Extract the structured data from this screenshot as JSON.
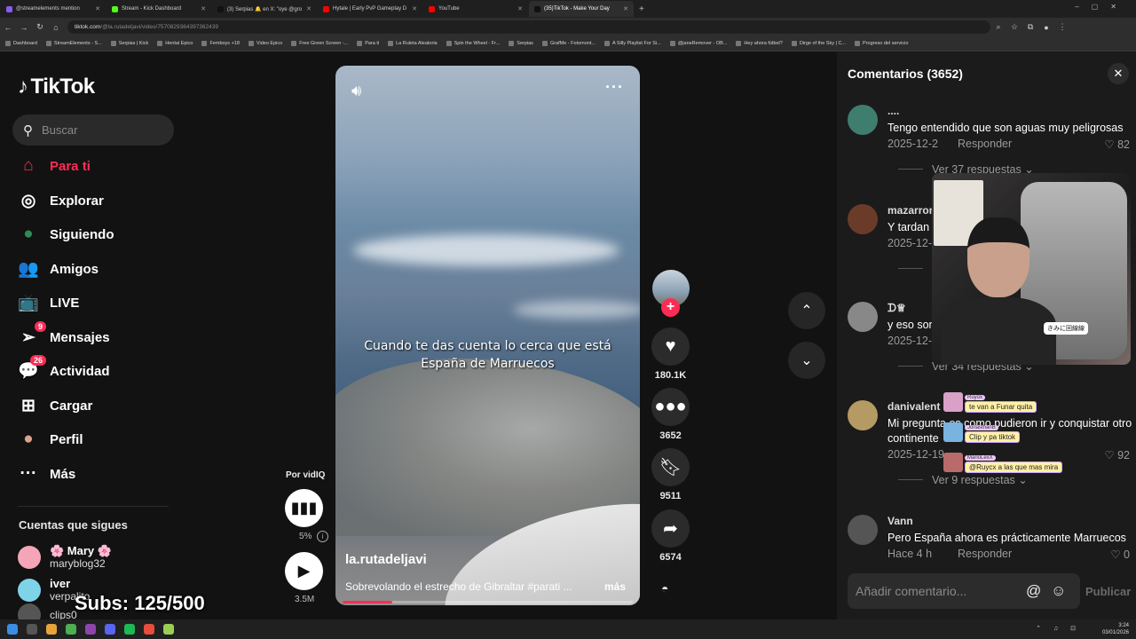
{
  "browser": {
    "tabs": [
      {
        "label": "@streamelements mention",
        "color": "#8a5cf6"
      },
      {
        "label": "Stream - Kick Dashboard",
        "color": "#53fc18"
      },
      {
        "label": "(3) Serpias 🔔 en X: \"oye @gro",
        "color": "#111111"
      },
      {
        "label": "Hytale | Early PvP Gameplay D",
        "color": "#ff0000"
      },
      {
        "label": "YouTube",
        "color": "#ff0000"
      },
      {
        "label": "(35)TikTok - Make Your Day",
        "color": "#111111",
        "active": true
      }
    ],
    "new_tab": "+",
    "url_host": "tiktok.com",
    "url_path": "/@la.rutadeljavi/video/7570829364397362439",
    "bookmarks": [
      "Dashboard",
      "StreamElements - S...",
      "Serpias | Kick",
      "Hentai Epico",
      "Femboys +18",
      "Video Epico",
      "Free Green Screen -...",
      "Para ti",
      "La Ruleta Aleatoria",
      "Spin the Wheel - Fr...",
      "Serpias",
      "GrafMe - Fotomont...",
      "A Silly Playlist For Si...",
      "@janeRemover - OB...",
      "Hey ahora fútbol?",
      "Dirge of the Sky | C...",
      "Progreso del servicio"
    ]
  },
  "sidebar": {
    "logo": "TikTok",
    "search_placeholder": "Buscar",
    "nav": [
      {
        "label": "Para ti",
        "icon": "home-icon",
        "glyph": "⌂",
        "active": true
      },
      {
        "label": "Explorar",
        "icon": "compass-icon",
        "glyph": "◎"
      },
      {
        "label": "Siguiendo",
        "icon": "following-avatar-icon",
        "glyph": "●"
      },
      {
        "label": "Amigos",
        "icon": "friends-icon",
        "glyph": "👥"
      },
      {
        "label": "LIVE",
        "icon": "live-icon",
        "glyph": "📺"
      },
      {
        "label": "Mensajes",
        "icon": "messages-icon",
        "glyph": "➢",
        "badge": "9"
      },
      {
        "label": "Actividad",
        "icon": "activity-icon",
        "glyph": "💬",
        "badge": "26"
      },
      {
        "label": "Cargar",
        "icon": "upload-icon",
        "glyph": "⊞"
      },
      {
        "label": "Perfil",
        "icon": "profile-avatar-icon",
        "glyph": "●"
      },
      {
        "label": "Más",
        "icon": "more-icon",
        "glyph": "···"
      }
    ],
    "following_title": "Cuentas que sigues",
    "following": [
      {
        "name": "🌸 Mary 🌸",
        "user": "maryblog32"
      },
      {
        "name": "iver",
        "user": "verpalito"
      },
      {
        "name": "",
        "user": "clips0"
      }
    ]
  },
  "subs_overlay": "Subs: 125/500",
  "video": {
    "caption": "Cuando te das cuenta lo cerca que está España de Marruecos",
    "author": "la.rutadeljavi",
    "description": "Sobrevolando el estrecho de Gibraltar #parati ...",
    "more": "más",
    "progress": 0.17
  },
  "actions": {
    "likes": "180.1K",
    "comments": "3652",
    "saves": "9511",
    "shares": "6574"
  },
  "vidiq": {
    "label": "Por vidIQ",
    "percent": "5%",
    "views": "3.5M"
  },
  "comments": {
    "title": "Comentarios (3652)",
    "items": [
      {
        "name": "....",
        "text": "Tengo entendido que son aguas muy peligrosas",
        "date": "2025-12-2",
        "reply": "Responder",
        "likes": "82",
        "replies": "Ver 37 respuestas",
        "avatar": "#3f7d6e"
      },
      {
        "name": "mazarron",
        "text": "Y tardan",
        "date": "2025-12-",
        "reply": "",
        "likes": "",
        "replies": "Ve",
        "avatar": "#6b3b2a"
      },
      {
        "name": "ᗪ♕",
        "text": "y eso son",
        "date": "2025-12-",
        "reply": "",
        "likes": "",
        "replies": "Ver 34 respuestas",
        "avatar": "#888888"
      },
      {
        "name": "danivalent",
        "text": "Mi pregunta es como pudieron ir y conquistar otro continente",
        "date": "2025-12-19",
        "reply": "",
        "likes": "92",
        "replies": "Ver 9 respuestas",
        "avatar": "#b59a63"
      },
      {
        "name": "Vann",
        "text": "Pero España ahora es prácticamente Marruecos",
        "date": "Hace 4 h",
        "reply": "Responder",
        "likes": "0",
        "replies": "",
        "avatar": "#555555"
      }
    ],
    "input_placeholder": "Añadir comentario...",
    "publish": "Publicar"
  },
  "chat_overlay": [
    {
      "user": "Ruyox",
      "msg": "te van a Funar quita"
    },
    {
      "user": "JonasthanB",
      "msg": "Clip y pa tiktok"
    },
    {
      "user": "MarioLexX",
      "msg": "@Ruycx a las que mas mira"
    }
  ],
  "webcam_label": "きみに回線線",
  "taskbar": {
    "time": "3:24",
    "date": "03/01/2026"
  }
}
